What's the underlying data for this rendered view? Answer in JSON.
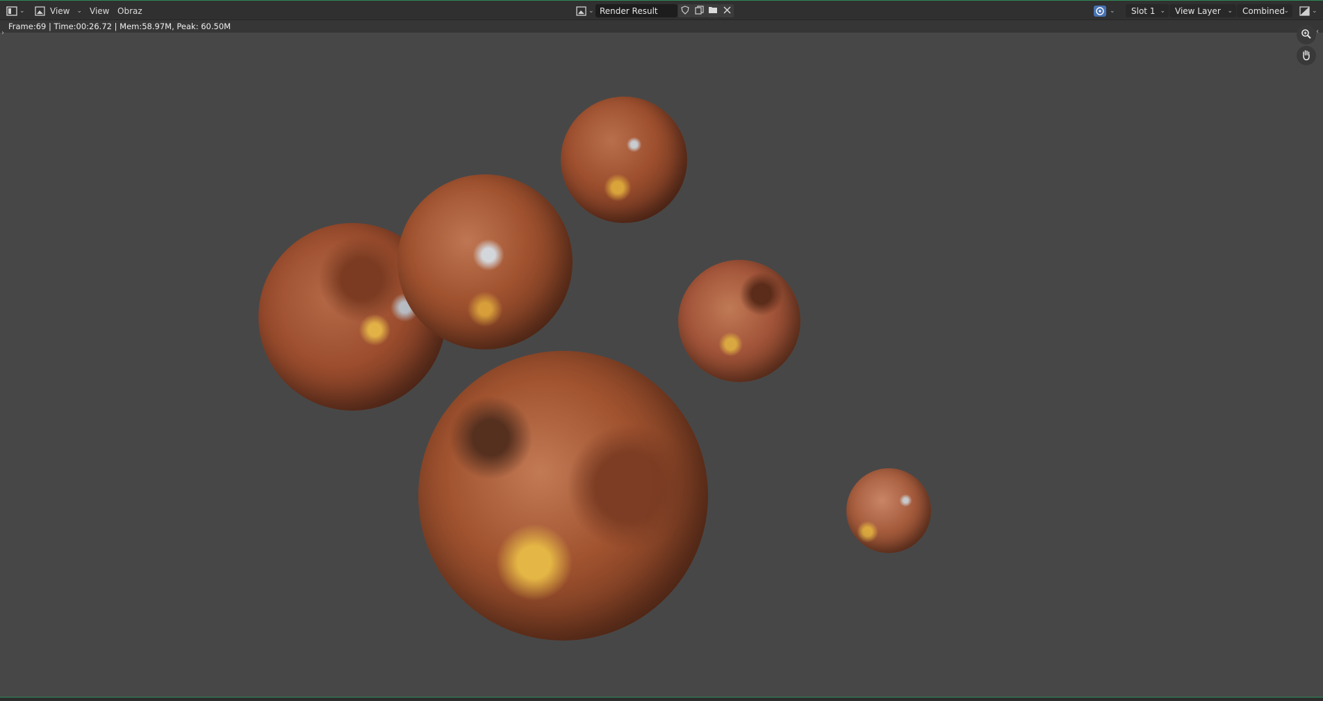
{
  "header": {
    "left_menus": [
      "View",
      "View",
      "Obraz"
    ],
    "image_name": "Render Result",
    "slot": "Slot 1",
    "view_layer": "View Layer",
    "pass": "Combined"
  },
  "render_info": "Frame:69 | Time:00:26.72 | Mem:58.97M, Peak: 60.50M",
  "icons": {
    "editor_type": "image-editor-icon",
    "mode": "image-icon",
    "browse_image": "image-browse-icon",
    "fake_user": "shield-icon",
    "new_image": "duplicate-icon",
    "open_image": "folder-icon",
    "unlink": "close-icon",
    "gizmo": "gizmo-icon",
    "display_channels": "display-channels-icon",
    "zoom": "zoom-icon",
    "pan": "hand-icon"
  },
  "colors": {
    "accent_green": "#2e8b57",
    "background": "#474747",
    "sphere_copper": "#a4532f"
  }
}
